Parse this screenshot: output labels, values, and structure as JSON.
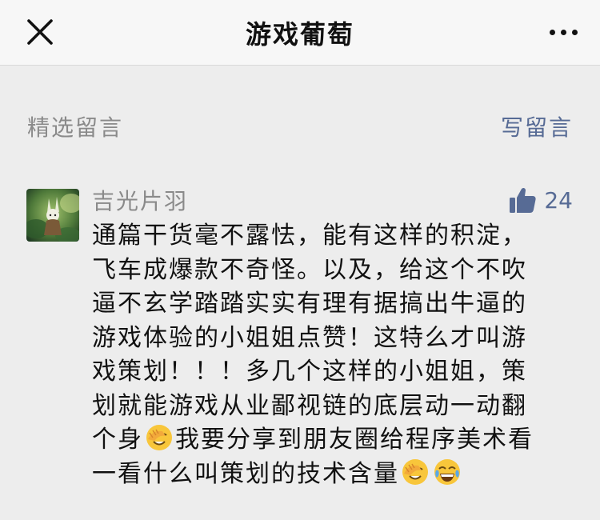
{
  "navbar": {
    "title": "游戏葡萄",
    "close_icon": "close-icon",
    "more_icon": "more-dots-icon"
  },
  "comments_section": {
    "title": "精选留言",
    "write_label": "写留言",
    "accent_color": "#576b95"
  },
  "comment": {
    "author": "吉光片羽",
    "likes": "24",
    "like_icon": "thumbs-up-icon",
    "lines": [
      "通篇干货毫不露怯，能有这样的积淀，",
      "飞车成爆款不奇怪。以及，给这个不吹",
      "逼不玄学踏踏实实有理有据搞出牛逼的",
      "游戏体验的小姐姐点赞！这特么才叫游",
      "戏策划！！！多几个这样的小姐姐，策",
      "划就能游戏从业鄙视链的底层动一动翻"
    ],
    "line7_a": "个身",
    "line7_b": "我要分享到朋友圈给程序美术看",
    "line8": "一看什么叫策划的技术含量",
    "emojis": [
      "facepalm-emoji",
      "facepalm-emoji",
      "tears-of-joy-emoji"
    ]
  }
}
